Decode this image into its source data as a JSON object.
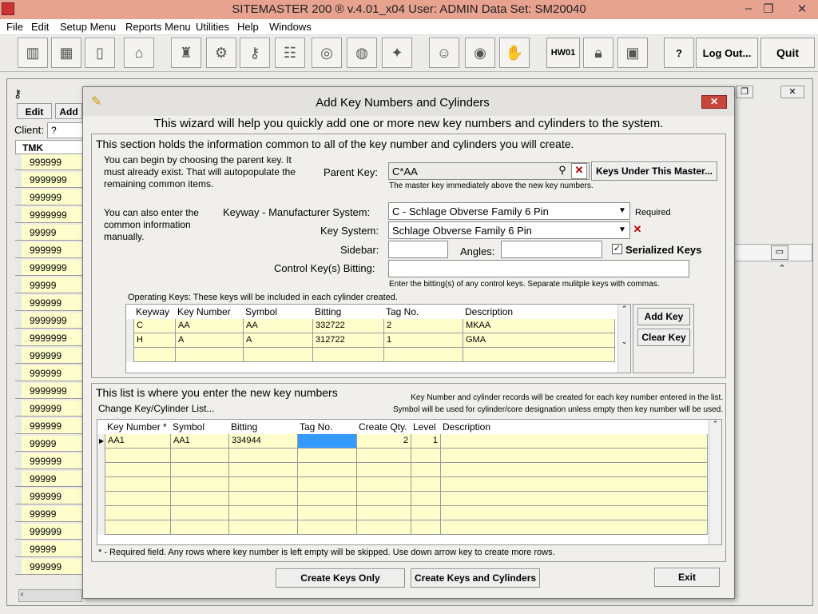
{
  "window": {
    "title": "SITEMASTER 200 ® v.4.01_x04    User: ADMIN    Data Set: SM20040",
    "min": "–",
    "max": "❐",
    "close": "✕"
  },
  "menu": [
    "File",
    "Edit",
    "Setup Menu",
    "Reports Menu",
    "Utilities",
    "Help",
    "Windows"
  ],
  "toolbar": {
    "hw": "HW01",
    "help": "?",
    "logout": "Log Out...",
    "quit": "Quit"
  },
  "bg": {
    "edit": "Edit",
    "add": "Add",
    "client_label": "Client:",
    "client_value": "?",
    "col": "TMK",
    "rows": [
      "999999",
      "9999999",
      "999999",
      "9999999",
      "99999",
      "999999",
      "9999999",
      "99999",
      "999999",
      "9999999",
      "9999999",
      "999999",
      "999999",
      "9999999",
      "999999",
      "999999",
      "99999",
      "999999",
      "99999",
      "999999",
      "99999",
      "999999",
      "99999",
      "999999"
    ]
  },
  "dialog": {
    "title": "Add Key Numbers and Cylinders",
    "intro": "This wizard will help you quickly add one or more new key numbers and cylinders to the system.",
    "sec1": "This section holds the information common to all of the key number and cylinders you will create.",
    "help1": "You can begin by choosing the parent key.  It must already exist.  That will autopopulate the remaining common items.",
    "parent_label": "Parent Key:",
    "parent_value": "C*AA",
    "keys_under_btn": "Keys Under This Master...",
    "parent_note": "The master key immediately above the new key numbers.",
    "help2": "You can also enter the common information manually.",
    "keyway_label": "Keyway - Manufacturer System:",
    "keyway_value": "C - Schlage Obverse Family 6 Pin",
    "required": "Required",
    "keysys_label": "Key System:",
    "keysys_value": "Schlage Obverse Family 6 Pin",
    "sidebar_label": "Sidebar:",
    "angles_label": "Angles:",
    "serialized_label": "Serialized Keys",
    "serialized_mark": "✓",
    "control_label": "Control Key(s) Bitting:",
    "control_note": "Enter the bitting(s) of any control keys.  Separate mulitple keys with commas.",
    "op_label": "Operating Keys:   These keys will be included in each cylinder created.",
    "op_cols": [
      "Keyway",
      "Key Number",
      "Symbol",
      "Bitting",
      "Tag No.",
      "Description"
    ],
    "op_rows": [
      [
        "C",
        "AA",
        "AA",
        "332722",
        "2",
        "MKAA"
      ],
      [
        "H",
        "A",
        "A",
        "312722",
        "1",
        "GMA"
      ]
    ],
    "add_key": "Add Key",
    "clear_key": "Clear Key",
    "sec2": "This list is where you enter the new key numbers",
    "sec2_note1": "Key Number and cylinder records will be created for each key number entered in the list.",
    "sec2_note2": "Symbol will be used for cylinder/core designation unless empty then key number will be used.",
    "change_list": "Change Key/Cylinder List...",
    "new_cols": [
      "Key Number *",
      "Symbol",
      "Bitting",
      "Tag No.",
      "Create Qty.",
      "Level",
      "Description"
    ],
    "new_rows": [
      [
        "AA1",
        "AA1",
        "334944",
        "",
        "2",
        "1",
        ""
      ]
    ],
    "footnote": "* - Required field.  Any rows where key number is left empty will be skipped.  Use down arrow key to create more rows.",
    "create_keys": "Create Keys Only",
    "create_both": "Create Keys and Cylinders",
    "exit": "Exit"
  }
}
